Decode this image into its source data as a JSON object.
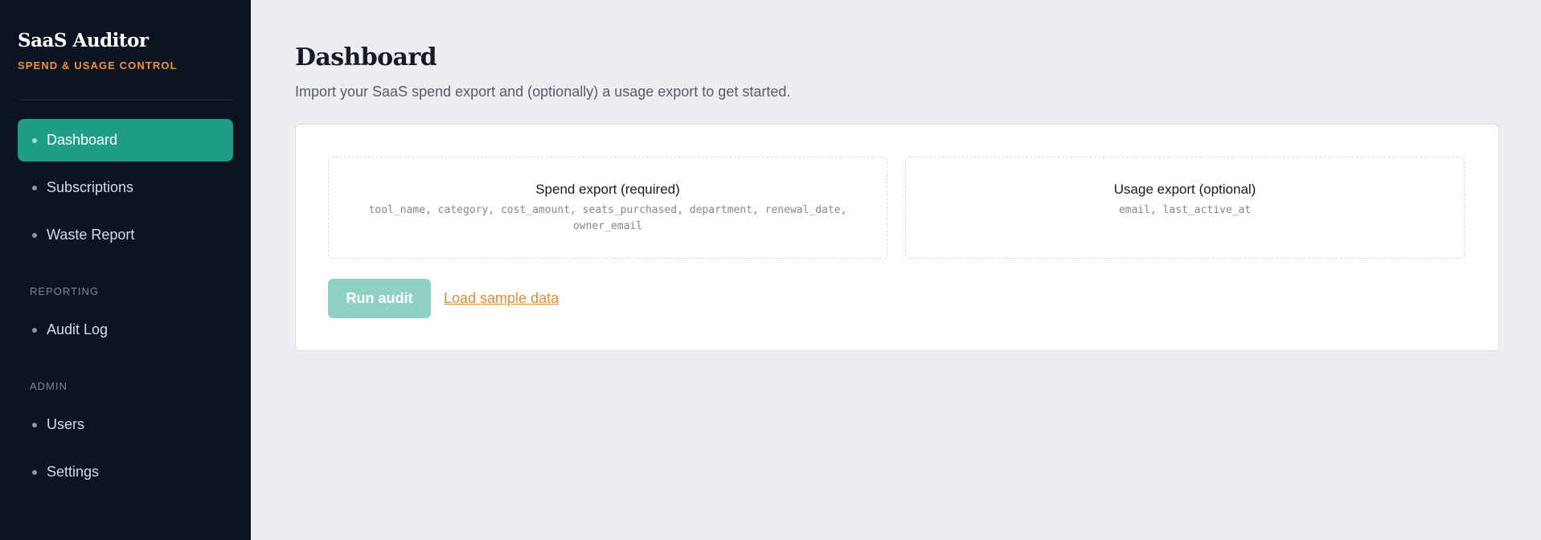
{
  "brand": {
    "title": "SaaS Auditor",
    "subtitle": "SPEND & USAGE CONTROL"
  },
  "sidebar": {
    "main_items": [
      {
        "label": "Dashboard",
        "active": true
      },
      {
        "label": "Subscriptions",
        "active": false
      },
      {
        "label": "Waste Report",
        "active": false
      }
    ],
    "reporting": {
      "heading": "REPORTING",
      "items": [
        {
          "label": "Audit Log"
        }
      ]
    },
    "admin": {
      "heading": "ADMIN",
      "items": [
        {
          "label": "Users"
        },
        {
          "label": "Settings"
        }
      ]
    }
  },
  "main": {
    "title": "Dashboard",
    "subtitle": "Import your SaaS spend export and (optionally) a usage export to get started.",
    "spend_drop": {
      "title": "Spend export (required)",
      "fields": "tool_name, category, cost_amount, seats_purchased, department, renewal_date, owner_email"
    },
    "usage_drop": {
      "title": "Usage export (optional)",
      "fields": "email, last_active_at"
    },
    "run_button": "Run audit",
    "sample_link": "Load sample data"
  },
  "colors": {
    "sidebar_bg": "#0d1421",
    "accent": "#1e9e87",
    "brand_orange": "#f0913a",
    "page_bg": "#eceef2"
  }
}
